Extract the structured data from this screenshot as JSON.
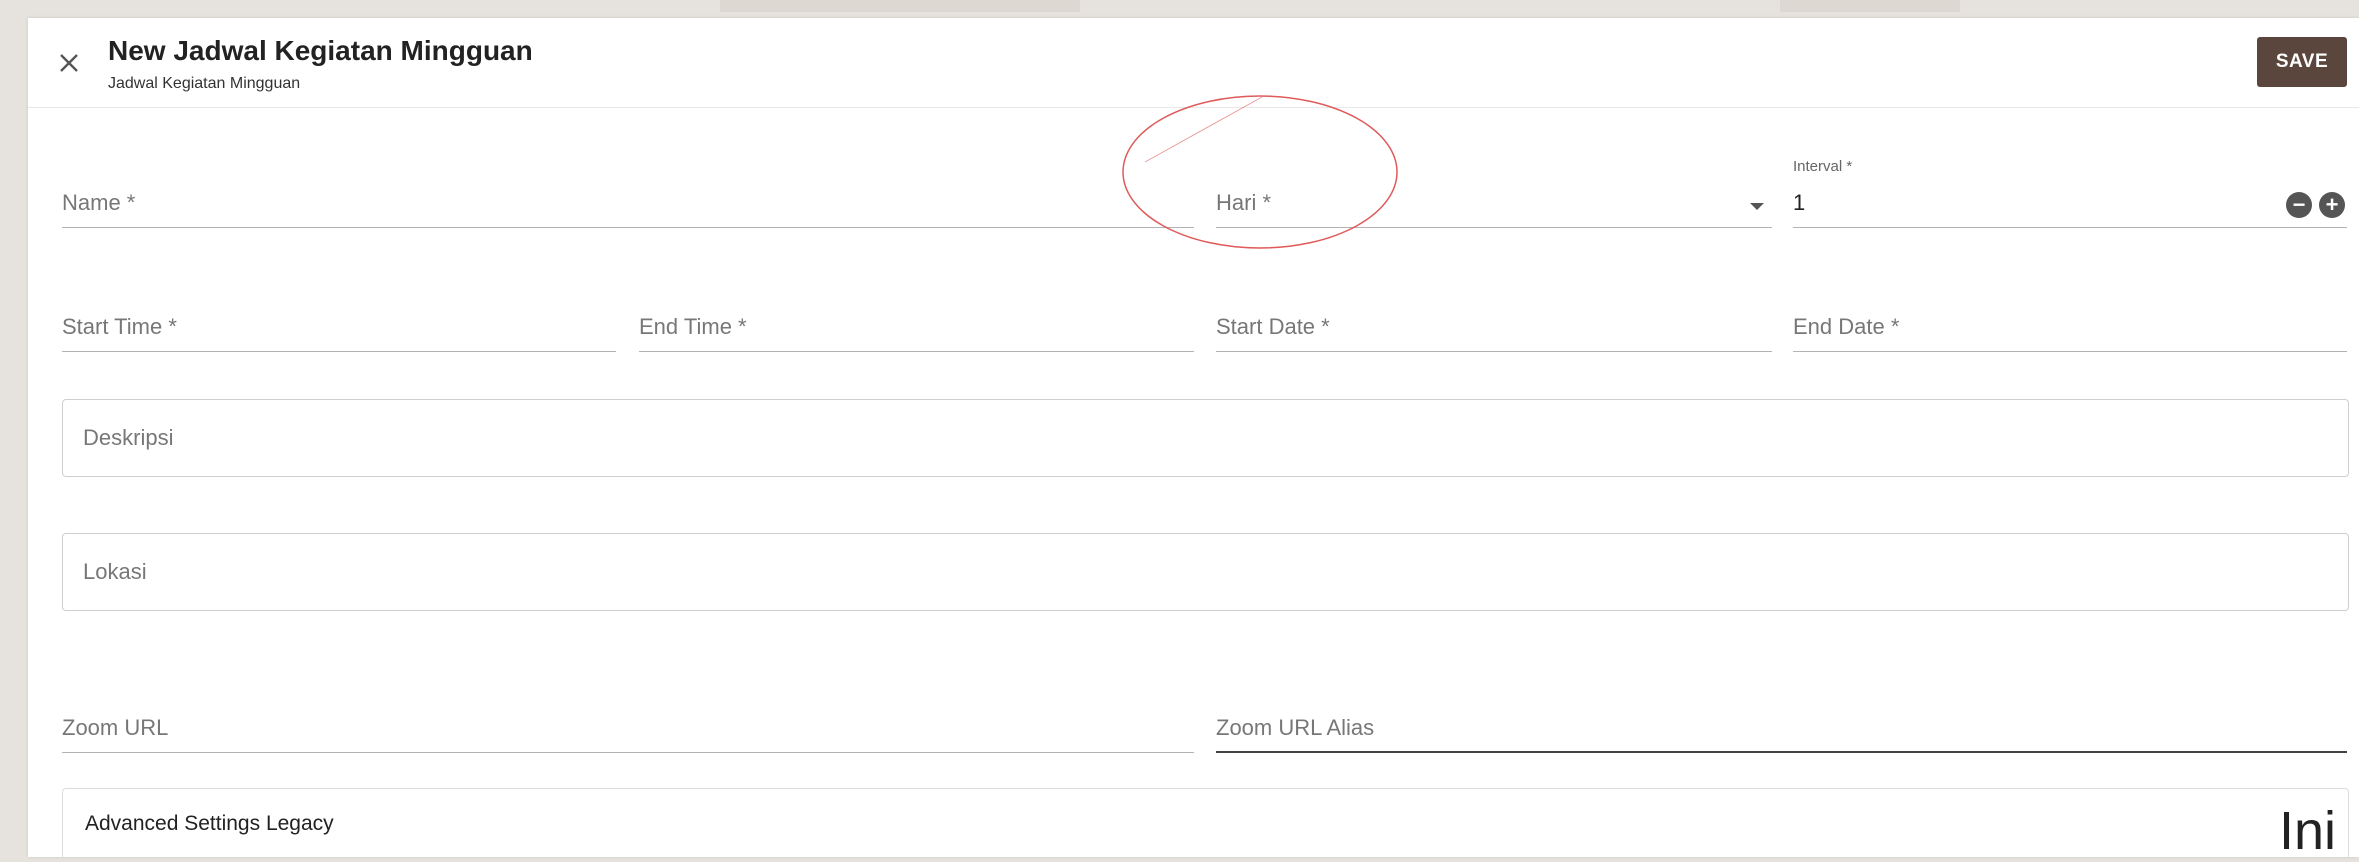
{
  "header": {
    "title": "New Jadwal Kegiatan Mingguan",
    "subtitle": "Jadwal Kegiatan Mingguan",
    "save_label": "SAVE"
  },
  "form": {
    "name": {
      "label": "Name *",
      "value": ""
    },
    "hari": {
      "label": "Hari *",
      "value": ""
    },
    "interval": {
      "label": "Interval *",
      "value": "1"
    },
    "start_time": {
      "label": "Start Time *",
      "value": ""
    },
    "end_time": {
      "label": "End Time *",
      "value": ""
    },
    "start_date": {
      "label": "Start Date *",
      "value": ""
    },
    "end_date": {
      "label": "End Date *",
      "value": ""
    },
    "deskripsi": {
      "label": "Deskripsi",
      "value": ""
    },
    "lokasi": {
      "label": "Lokasi",
      "value": ""
    },
    "zoom_url": {
      "label": "Zoom URL",
      "value": ""
    },
    "zoom_url_alias": {
      "label": "Zoom URL Alias",
      "value": ""
    }
  },
  "advanced": {
    "label": "Advanced Settings Legacy"
  },
  "annotation": {
    "corner_text": "Ini",
    "ellipse_color": "#e05a5a"
  },
  "icons": [
    "close-icon",
    "chevron-down-icon",
    "minus-circle-icon",
    "plus-circle-icon"
  ],
  "colors": {
    "save_button": "#5a463c",
    "background": "#e6e2dd"
  }
}
